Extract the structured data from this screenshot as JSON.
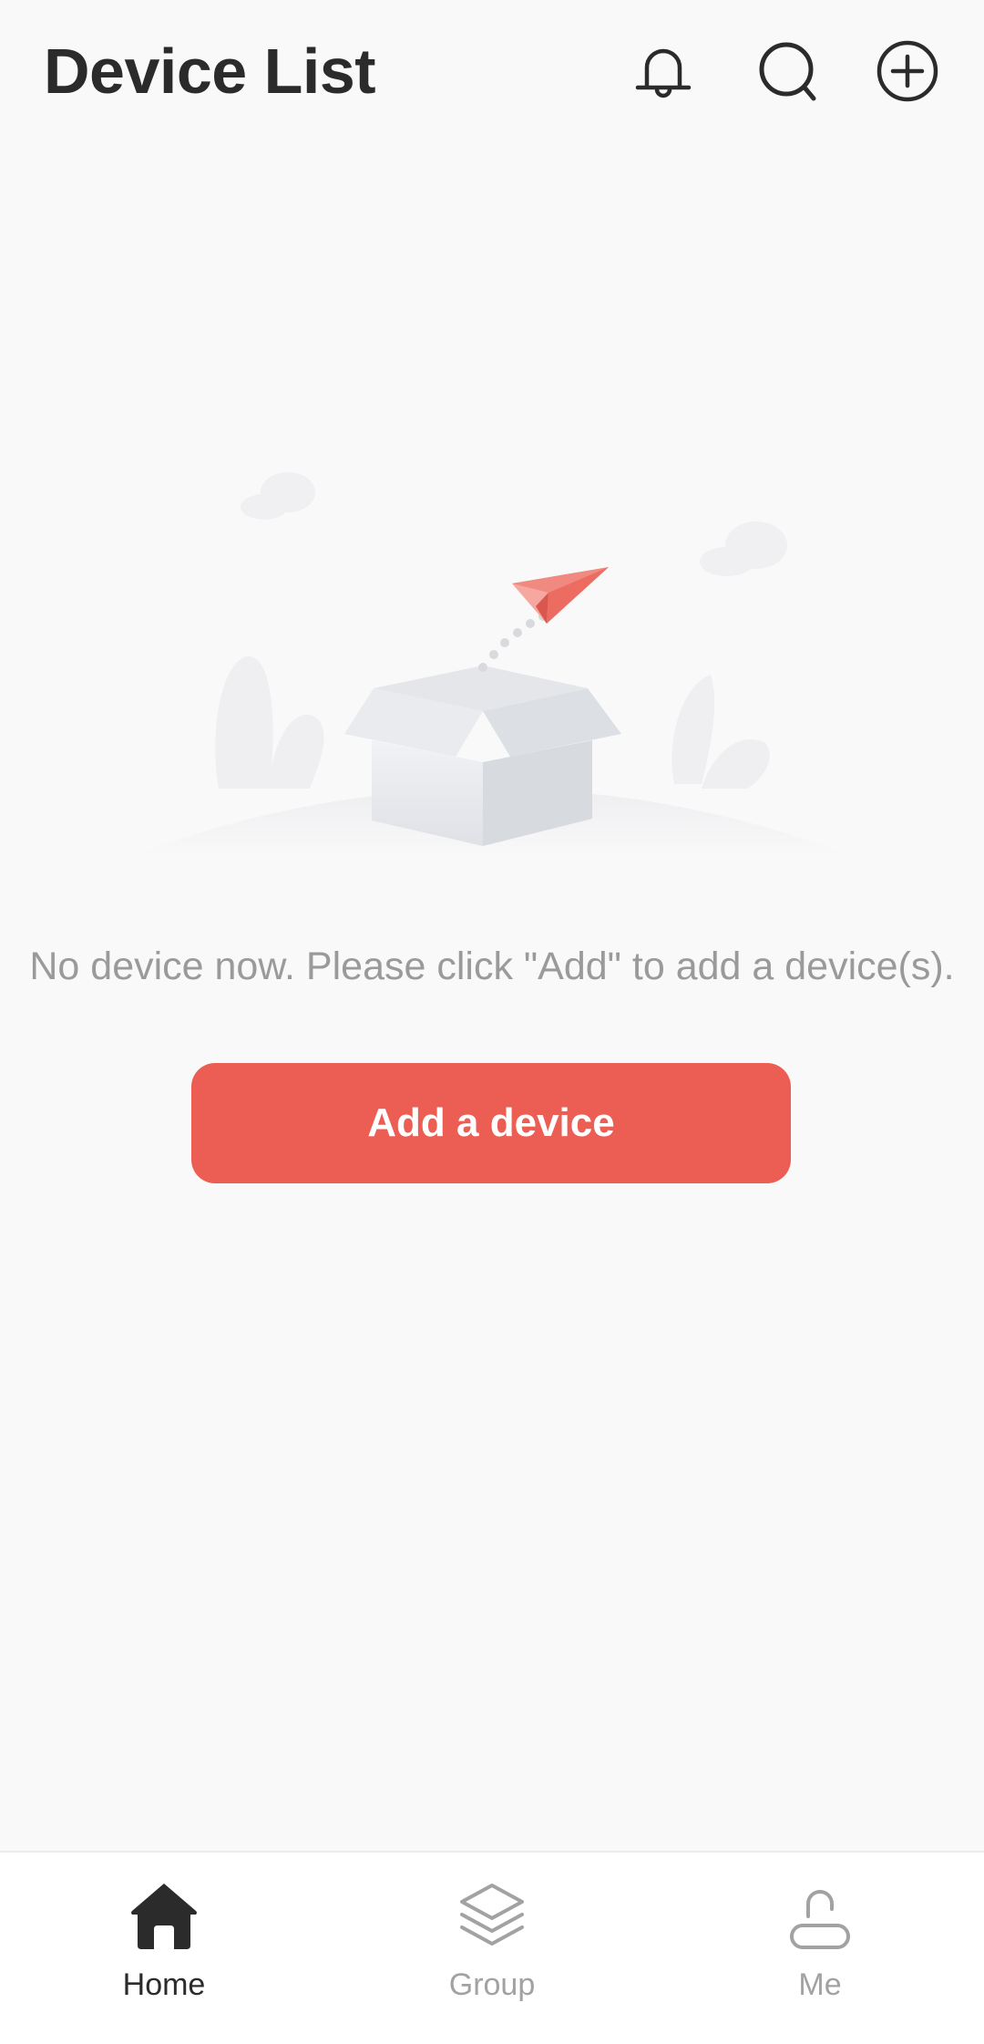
{
  "header": {
    "title": "Device List",
    "icons": {
      "notifications": "bell-icon",
      "search": "search-icon",
      "add": "plus-circle-icon"
    }
  },
  "empty_state": {
    "illustration": "empty-box-paper-plane",
    "message": "No device now. Please click \"Add\" to add a device(s).",
    "button_label": "Add a device"
  },
  "tabbar": {
    "items": [
      {
        "label": "Home",
        "icon": "home-icon",
        "active": true
      },
      {
        "label": "Group",
        "icon": "layers-icon",
        "active": false
      },
      {
        "label": "Me",
        "icon": "person-icon",
        "active": false
      }
    ]
  },
  "colors": {
    "accent": "#ec5d53",
    "title": "#2b2b2b",
    "muted": "#9a9a9a",
    "background": "#f9f9f9"
  }
}
